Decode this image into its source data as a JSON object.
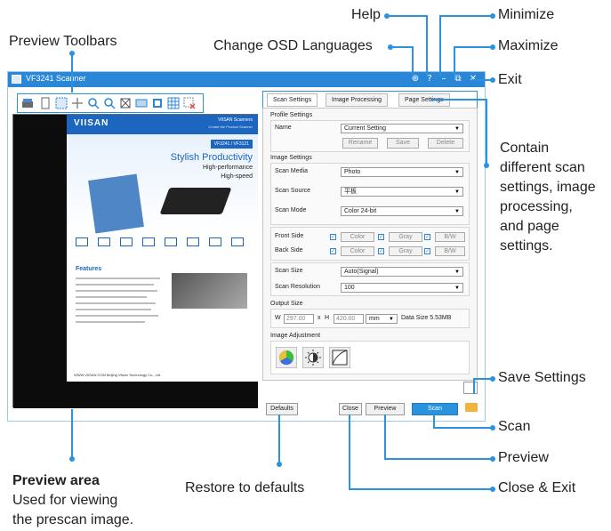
{
  "annotations": {
    "help": "Help",
    "minimize": "Minimize",
    "change_osd": "Change OSD Languages",
    "maximize": "Maximize",
    "preview_toolbars": "Preview Toolbars",
    "exit": "Exit",
    "contain_lines": [
      "Contain",
      "different scan",
      "settings, image",
      "processing,",
      "and page",
      "settings."
    ],
    "save_settings": "Save Settings",
    "scan": "Scan",
    "preview": "Preview",
    "close_exit": "Close & Exit",
    "restore_defaults": "Restore to defaults",
    "preview_area_title": "Preview area",
    "preview_area_desc": [
      "Used for viewing",
      "the prescan image."
    ]
  },
  "window": {
    "title": "VF3241 Scanner",
    "controls": {
      "lang": "⊕",
      "help": "?",
      "minimize": "–",
      "maximize": "⧉",
      "close": "✕"
    }
  },
  "document": {
    "brand": "VIISAN",
    "header_right": [
      "VIISAN Scanners",
      "Create the Product Scanner"
    ],
    "tag": "VF3241 / VF3121",
    "headline": "Stylish Productivity",
    "lines": [
      "High-performance",
      "High-speed"
    ],
    "features_title": "Features",
    "footer": "WWW.VIISAN.COM   Beijing Viisan Technology Co., Ltd."
  },
  "tabs": [
    "Scan Settings",
    "Image Processing",
    "Page Settings"
  ],
  "profile": {
    "title": "Profile Settings",
    "name_label": "Name",
    "name_value": "Current Setting",
    "buttons": [
      "Rename",
      "Save",
      "Delete"
    ]
  },
  "image_settings": {
    "title": "Image Settings",
    "rows": [
      {
        "label": "Scan Media",
        "value": "Photo"
      },
      {
        "label": "Scan Source",
        "value": "平板"
      },
      {
        "label": "Scan Mode",
        "value": "Color 24-bit"
      }
    ],
    "front_label": "Front Side",
    "back_label": "Back Side",
    "color_buttons": [
      "Color",
      "Gray",
      "B/W"
    ],
    "scan_size_label": "Scan Size",
    "scan_size_value": "Auto(Signal)",
    "resolution_label": "Scan Resolution",
    "resolution_value": "100"
  },
  "output": {
    "title": "Output Size",
    "w_label": "W",
    "w_value": "297.00",
    "x_label": "x",
    "h_label": "H",
    "h_value": "420.00",
    "unit": "mm",
    "data_size": "Data Size 5.53MB"
  },
  "adjustment": {
    "title": "Image Adjustment"
  },
  "bottom": {
    "defaults": "Defaults",
    "close": "Close",
    "preview": "Preview",
    "scan": "Scan"
  },
  "colors": {
    "accent": "#2a93e0",
    "titlebar": "#2a86d6"
  }
}
